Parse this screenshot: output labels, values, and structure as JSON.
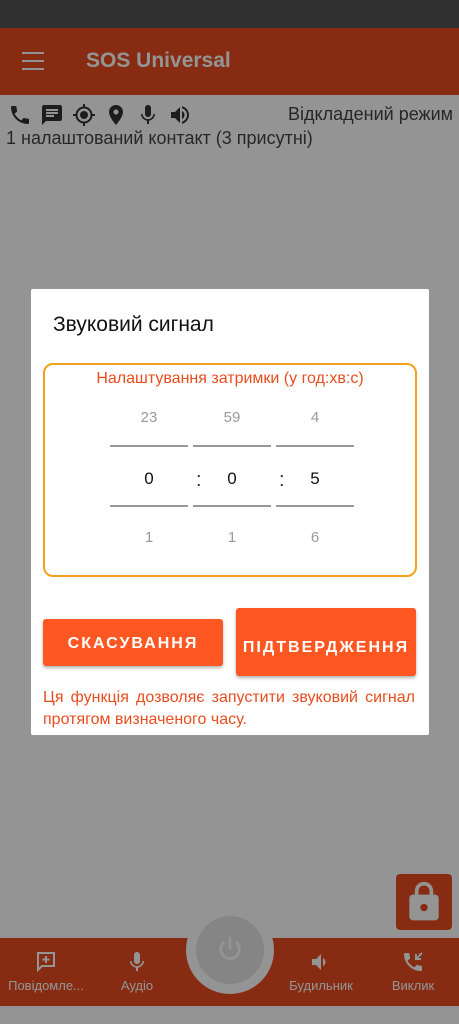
{
  "colors": {
    "accent": "#e84d1f",
    "button": "#ff5722",
    "frame": "#f2a11a"
  },
  "app": {
    "title": "SOS Universal"
  },
  "status": {
    "icons": [
      "phone-icon",
      "message-icon",
      "gps-target-icon",
      "location-pin-icon",
      "microphone-icon",
      "speaker-icon"
    ],
    "mode": "Відкладений режим",
    "contacts": "1 налаштований контакт (3 присутні)"
  },
  "dialog": {
    "title": "Звуковий сигнал",
    "delay_label": "Налаштування затримки (у год:хв:с)",
    "hours": {
      "prev": "23",
      "value": "0",
      "next": "1"
    },
    "minutes": {
      "prev": "59",
      "value": "0",
      "next": "1"
    },
    "seconds": {
      "prev": "4",
      "value": "5",
      "next": "6"
    },
    "separator": ":",
    "cancel_label": "СКАСУВАННЯ",
    "confirm_label": "ПІДТВЕРДЖЕННЯ",
    "description": "Ця функція дозволяє запустити звуковий сигнал протягом визначеного часу."
  },
  "bottom_nav": {
    "messages": "Повідомле...",
    "audio": "Аудіо",
    "alarm": "Будильник",
    "call": "Виклик"
  }
}
